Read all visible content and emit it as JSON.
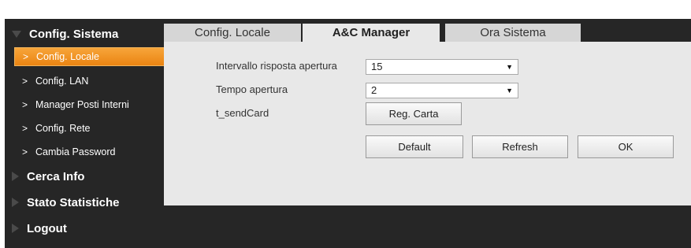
{
  "sidebar": {
    "sections": [
      {
        "label": "Config. Sistema",
        "expanded": true
      },
      {
        "label": "Cerca Info",
        "expanded": false
      },
      {
        "label": "Stato Statistiche",
        "expanded": false
      },
      {
        "label": "Logout",
        "expanded": false
      }
    ],
    "items": [
      {
        "label": "Config. Locale",
        "active": true
      },
      {
        "label": "Config. LAN"
      },
      {
        "label": "Manager Posti Interni"
      },
      {
        "label": "Config. Rete"
      },
      {
        "label": "Cambia Password"
      }
    ],
    "chevron": ">"
  },
  "tabs": [
    {
      "label": "Config. Locale"
    },
    {
      "label": "A&C Manager",
      "active": true
    },
    {
      "label": "Ora Sistema"
    }
  ],
  "form": {
    "intervallo_label": "Intervallo risposta apertura",
    "intervallo_value": "15",
    "tempo_label": "Tempo apertura",
    "tempo_value": "2",
    "sendcard_label": "t_sendCard",
    "reg_carta_label": "Reg. Carta",
    "select_arrow": "▼"
  },
  "buttons": {
    "default_label": "Default",
    "refresh_label": "Refresh",
    "ok_label": "OK"
  },
  "colors": {
    "active_item": "#f0951f",
    "frame": "#262626",
    "panel": "#e8e8e8",
    "inactive_tab": "#d6d6d6"
  }
}
